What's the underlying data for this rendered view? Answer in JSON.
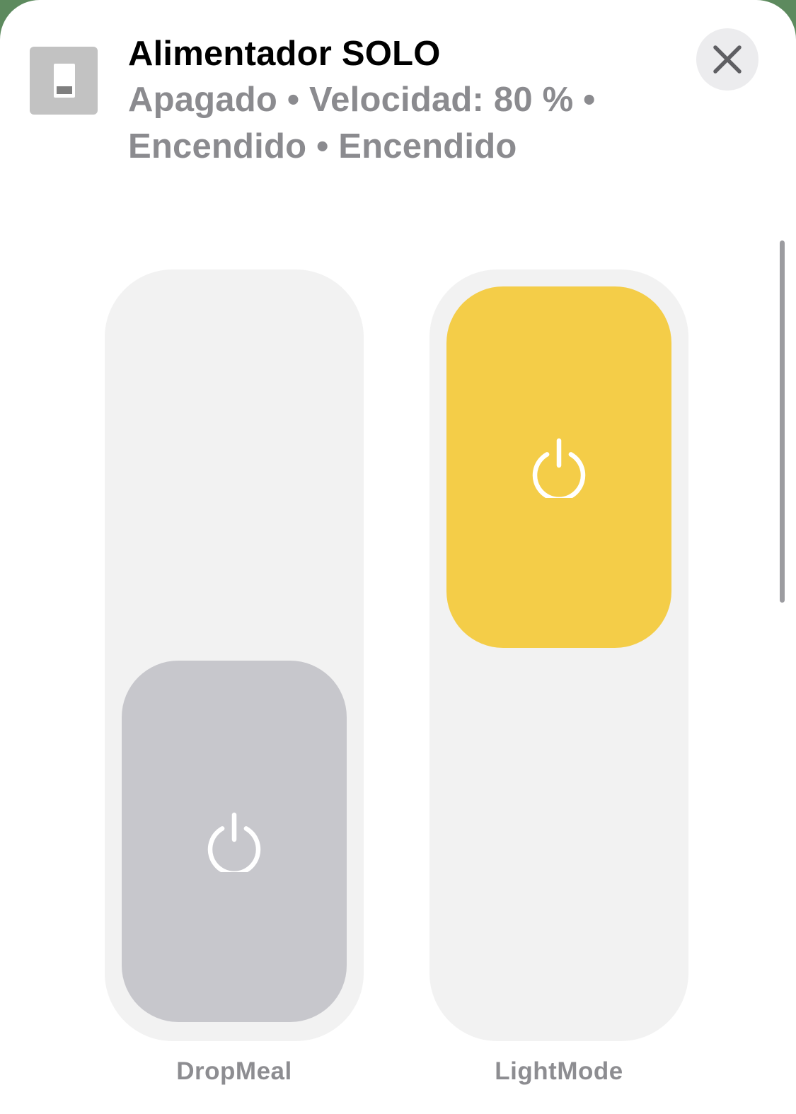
{
  "accessory": {
    "title": "Alimentador SOLO",
    "status_line_1": "Apagado • Velocidad: 80 % •",
    "status_line_2": "Encendido • Encendido",
    "icon": "light-switch-icon"
  },
  "close_button": {
    "icon": "close-icon"
  },
  "switches": [
    {
      "label": "DropMeal",
      "state": "off",
      "icon": "power-icon",
      "color": "#c7c7cc"
    },
    {
      "label": "LightMode",
      "state": "on",
      "icon": "power-icon",
      "color": "#f4cd48"
    }
  ],
  "colors": {
    "sheet_background": "#ffffff",
    "track": "#f2f2f2",
    "secondary_text": "#8b8b8f",
    "close_button_background": "#ececee",
    "on_accent": "#f4cd48",
    "off_knob": "#c7c7cc"
  }
}
